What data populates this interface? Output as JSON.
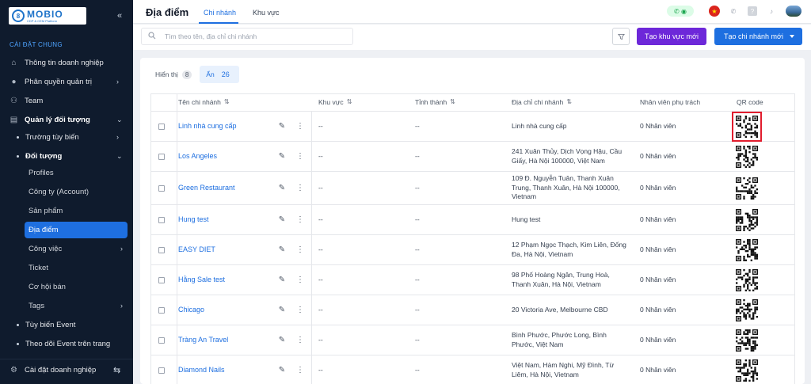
{
  "brand": {
    "logo_text": "MOBIO",
    "logo_sub": "CDP & CEM Platform",
    "logo_mark": "8"
  },
  "sidebar": {
    "section_label": "CÀI ĐẶT CHUNG",
    "items": [
      {
        "label": "Thông tin doanh nghiệp",
        "icon": "house-icon"
      },
      {
        "label": "Phân quyền quản trị",
        "icon": "user-shield-icon"
      },
      {
        "label": "Team",
        "icon": "team-icon"
      },
      {
        "label": "Quản lý đối tượng",
        "icon": "database-icon"
      }
    ],
    "sub_items": [
      {
        "label": "Trường tùy biến"
      },
      {
        "label": "Đối tượng"
      }
    ],
    "leaf_items": [
      {
        "label": "Profiles"
      },
      {
        "label": "Công ty (Account)"
      },
      {
        "label": "Sản phẩm"
      },
      {
        "label": "Địa điểm"
      },
      {
        "label": "Công việc"
      },
      {
        "label": "Ticket"
      },
      {
        "label": "Cơ hội bán"
      },
      {
        "label": "Tags"
      }
    ],
    "sub_items_2": [
      {
        "label": "Tùy biến Event"
      },
      {
        "label": "Theo dõi Event trên trang"
      }
    ],
    "bottom": {
      "label": "Cài đặt doanh nghiệp"
    }
  },
  "header": {
    "title": "Địa điểm",
    "tabs": [
      {
        "label": "Chi nhánh"
      },
      {
        "label": "Khu vực"
      }
    ]
  },
  "toolbar": {
    "search_placeholder": "Tìm theo tên, địa chỉ chi nhánh",
    "create_area_label": "Tạo khu vực mới",
    "create_branch_label": "Tạo chi nhánh mới"
  },
  "view_toggle": {
    "show_label": "Hiển thị",
    "show_count": "8",
    "hide_label": "Ẩn",
    "hide_count": "26"
  },
  "table": {
    "columns": [
      "Tên chi nhánh",
      "Khu vực",
      "Tỉnh thành",
      "Địa chỉ chi nhánh",
      "Nhân viên phụ trách",
      "QR code"
    ],
    "rows": [
      {
        "name": "Linh nhà cung cấp",
        "area": "--",
        "province": "--",
        "address": "Linh nhà cung cấp",
        "staff": "0 Nhân viên"
      },
      {
        "name": "Los Angeles",
        "area": "--",
        "province": "--",
        "address": "241 Xuân Thủy, Dịch Vọng Hậu, Cầu Giấy, Hà Nội 100000, Việt Nam",
        "staff": "0 Nhân viên"
      },
      {
        "name": "Green Restaurant",
        "area": "--",
        "province": "--",
        "address": "109 Đ. Nguyễn Tuân, Thanh Xuân Trung, Thanh Xuân, Hà Nội 100000, Vietnam",
        "staff": "0 Nhân viên"
      },
      {
        "name": "Hung test",
        "area": "--",
        "province": "--",
        "address": "Hung test",
        "staff": "0 Nhân viên"
      },
      {
        "name": "EASY DIET",
        "area": "--",
        "province": "--",
        "address": "12 Phạm Ngọc Thạch, Kim Liên, Đống Đa, Hà Nội, Vietnam",
        "staff": "0 Nhân viên"
      },
      {
        "name": "Hằng Sale test",
        "area": "--",
        "province": "--",
        "address": "98 Phố Hoàng Ngân, Trung Hoà, Thanh Xuân, Hà Nội, Vietnam",
        "staff": "0 Nhân viên"
      },
      {
        "name": "Chicago",
        "area": "--",
        "province": "--",
        "address": "20 Victoria Ave, Melbourne CBD",
        "staff": "0 Nhân viên"
      },
      {
        "name": "Tràng An Travel",
        "area": "--",
        "province": "--",
        "address": "Bình Phước, Phước Long, Bình Phước, Việt Nam",
        "staff": "0 Nhân viên"
      },
      {
        "name": "Diamond Nails",
        "area": "--",
        "province": "--",
        "address": "Việt Nam, Hàm Nghi, Mỹ Đình, Từ Liêm, Hà Nội, Vietnam",
        "staff": "0 Nhân viên"
      }
    ]
  },
  "colors": {
    "primary": "#1e6fe0",
    "purple": "#6d28d9",
    "sidebar_bg": "#0f1b2d",
    "highlight": "#e11d2e"
  }
}
